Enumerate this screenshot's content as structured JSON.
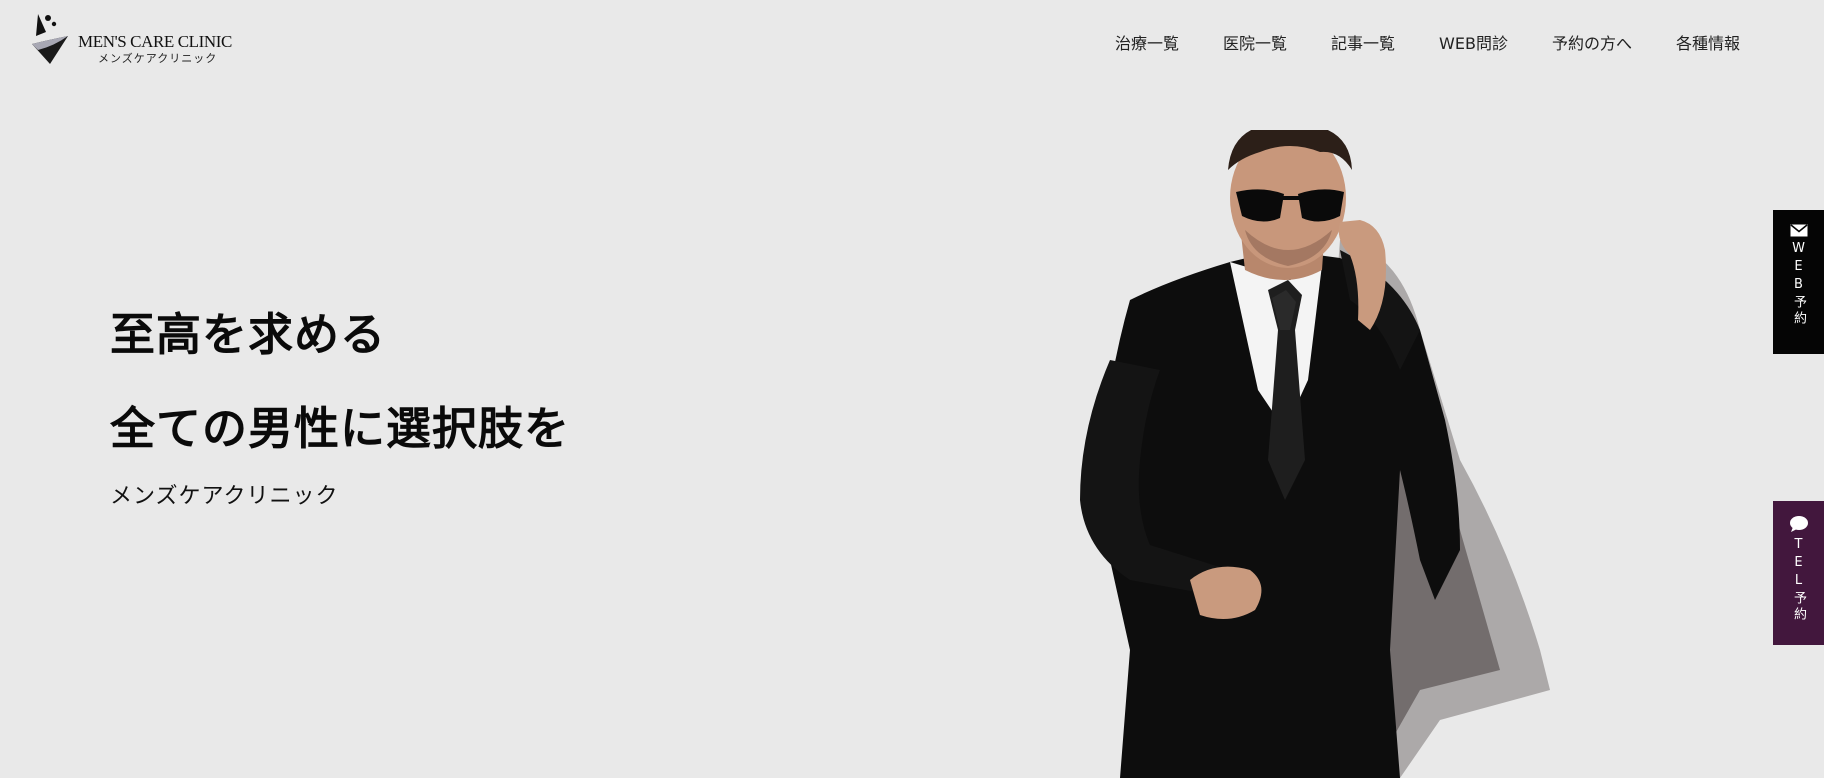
{
  "header": {
    "logo_name": "MEN'S CARE CLINIC",
    "logo_sub": "メンズケアクリニック",
    "nav": [
      {
        "label": "治療一覧"
      },
      {
        "label": "医院一覧"
      },
      {
        "label": "記事一覧"
      },
      {
        "label": "WEB問診"
      },
      {
        "label": "予約の方へ"
      },
      {
        "label": "各種情報"
      }
    ]
  },
  "hero": {
    "line1": "至高を求める",
    "line2": "全ての男性に選択肢を",
    "sub": "メンズケアクリニック"
  },
  "side_tabs": {
    "web": {
      "label": "WEB予約",
      "icon": "mail-icon",
      "color": "#050505"
    },
    "tel": {
      "label": "TEL予約",
      "icon": "chat-bubble-icon",
      "color": "#42173d"
    }
  },
  "colors": {
    "background": "#e9e9e9",
    "text": "#111111"
  }
}
